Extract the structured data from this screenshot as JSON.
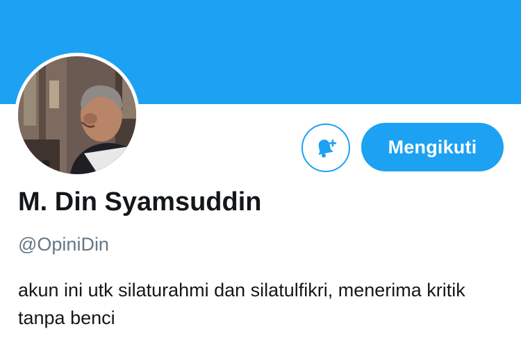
{
  "colors": {
    "banner": "#1da1f2",
    "accent": "#1da1f2",
    "name_text": "#14171a",
    "handle_text": "#657786"
  },
  "profile": {
    "avatar_icon": "profile-photo",
    "display_name": "M. Din Syamsuddin",
    "handle": "@OpiniDin",
    "bio": "akun ini utk silaturahmi dan silatulfikri, menerima kritik tanpa benci"
  },
  "actions": {
    "notify_icon": "bell-plus-icon",
    "follow_label": "Mengikuti"
  }
}
